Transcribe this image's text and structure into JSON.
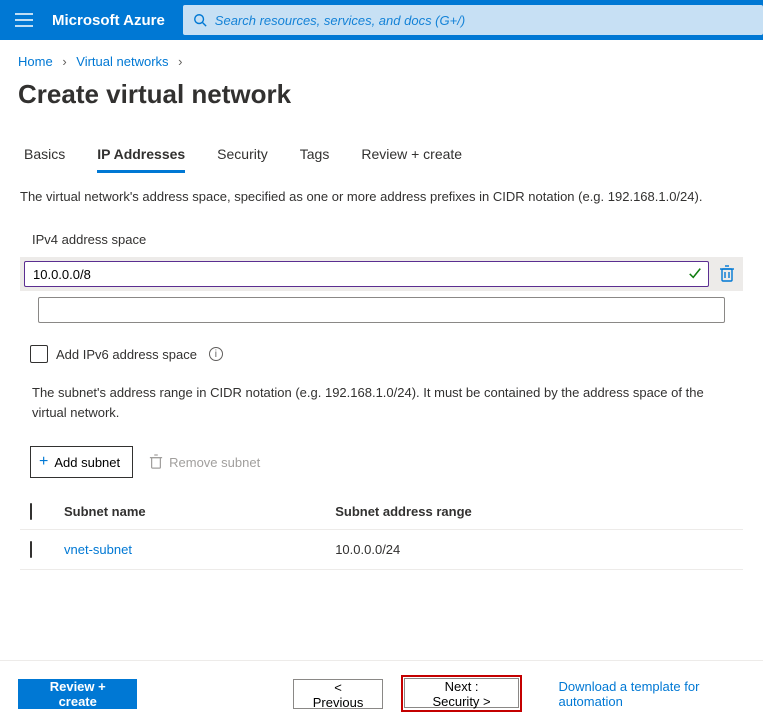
{
  "header": {
    "brand": "Microsoft Azure",
    "search_placeholder": "Search resources, services, and docs (G+/)"
  },
  "breadcrumb": {
    "home": "Home",
    "vnet": "Virtual networks"
  },
  "page": {
    "title": "Create virtual network"
  },
  "tabs": {
    "basics": "Basics",
    "ip": "IP Addresses",
    "security": "Security",
    "tags": "Tags",
    "review": "Review + create"
  },
  "ip": {
    "description": "The virtual network's address space, specified as one or more address prefixes in CIDR notation (e.g. 192.168.1.0/24).",
    "section_label": "IPv4 address space",
    "address_value": "10.0.0.0/8",
    "ipv6_label": "Add IPv6 address space",
    "subnet_description": "The subnet's address range in CIDR notation (e.g. 192.168.1.0/24). It must be contained by the address space of the virtual network.",
    "add_subnet": "Add subnet",
    "remove_subnet": "Remove subnet",
    "col_name": "Subnet name",
    "col_range": "Subnet address range",
    "subnet": {
      "name": "vnet-subnet",
      "range": "10.0.0.0/24"
    }
  },
  "footer": {
    "review": "Review + create",
    "previous": "< Previous",
    "next": "Next : Security >",
    "download": "Download a template for automation"
  }
}
